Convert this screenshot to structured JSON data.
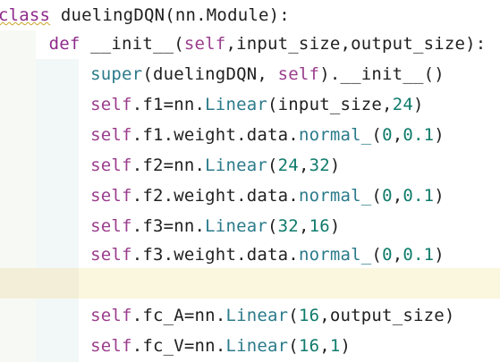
{
  "editor": {
    "lines": [
      {
        "parts": [
          {
            "t": "class",
            "c": "kw",
            "sq": true
          },
          {
            "t": " duelingDQN",
            "c": "cls"
          },
          {
            "t": "(",
            "c": "op"
          },
          {
            "t": "nn",
            "c": "id"
          },
          {
            "t": ".",
            "c": "op"
          },
          {
            "t": "Module",
            "c": "id"
          },
          {
            "t": "):",
            "c": "op"
          }
        ]
      },
      {
        "parts": [
          {
            "t": "    ",
            "c": "op"
          },
          {
            "t": "def",
            "c": "kw"
          },
          {
            "t": " ",
            "c": "op"
          },
          {
            "t": "__init__",
            "c": "fn"
          },
          {
            "t": "(",
            "c": "op"
          },
          {
            "t": "self",
            "c": "self"
          },
          {
            "t": ",",
            "c": "op"
          },
          {
            "t": "input_size",
            "c": "id"
          },
          {
            "t": ",",
            "c": "op"
          },
          {
            "t": "output_size",
            "c": "id"
          },
          {
            "t": "):",
            "c": "op"
          }
        ]
      },
      {
        "parts": [
          {
            "t": "        ",
            "c": "op"
          },
          {
            "t": "super",
            "c": "call"
          },
          {
            "t": "(",
            "c": "op"
          },
          {
            "t": "duelingDQN",
            "c": "id"
          },
          {
            "t": ", ",
            "c": "op"
          },
          {
            "t": "self",
            "c": "self"
          },
          {
            "t": ").",
            "c": "op"
          },
          {
            "t": "__init__",
            "c": "fn"
          },
          {
            "t": "()",
            "c": "op"
          }
        ]
      },
      {
        "parts": [
          {
            "t": "        ",
            "c": "op"
          },
          {
            "t": "self",
            "c": "self"
          },
          {
            "t": ".",
            "c": "op"
          },
          {
            "t": "f1",
            "c": "id"
          },
          {
            "t": "=",
            "c": "op"
          },
          {
            "t": "nn",
            "c": "id"
          },
          {
            "t": ".",
            "c": "op"
          },
          {
            "t": "Linear",
            "c": "call"
          },
          {
            "t": "(",
            "c": "op"
          },
          {
            "t": "input_size",
            "c": "id"
          },
          {
            "t": ",",
            "c": "op"
          },
          {
            "t": "24",
            "c": "num"
          },
          {
            "t": ")",
            "c": "op"
          }
        ]
      },
      {
        "parts": [
          {
            "t": "        ",
            "c": "op"
          },
          {
            "t": "self",
            "c": "self"
          },
          {
            "t": ".",
            "c": "op"
          },
          {
            "t": "f1",
            "c": "id"
          },
          {
            "t": ".",
            "c": "op"
          },
          {
            "t": "weight",
            "c": "id"
          },
          {
            "t": ".",
            "c": "op"
          },
          {
            "t": "data",
            "c": "id"
          },
          {
            "t": ".",
            "c": "op"
          },
          {
            "t": "normal_",
            "c": "call"
          },
          {
            "t": "(",
            "c": "op"
          },
          {
            "t": "0",
            "c": "num"
          },
          {
            "t": ",",
            "c": "op"
          },
          {
            "t": "0.1",
            "c": "num"
          },
          {
            "t": ")",
            "c": "op"
          }
        ]
      },
      {
        "parts": [
          {
            "t": "        ",
            "c": "op"
          },
          {
            "t": "self",
            "c": "self"
          },
          {
            "t": ".",
            "c": "op"
          },
          {
            "t": "f2",
            "c": "id"
          },
          {
            "t": "=",
            "c": "op"
          },
          {
            "t": "nn",
            "c": "id"
          },
          {
            "t": ".",
            "c": "op"
          },
          {
            "t": "Linear",
            "c": "call"
          },
          {
            "t": "(",
            "c": "op"
          },
          {
            "t": "24",
            "c": "num"
          },
          {
            "t": ",",
            "c": "op"
          },
          {
            "t": "32",
            "c": "num"
          },
          {
            "t": ")",
            "c": "op"
          }
        ]
      },
      {
        "parts": [
          {
            "t": "        ",
            "c": "op"
          },
          {
            "t": "self",
            "c": "self"
          },
          {
            "t": ".",
            "c": "op"
          },
          {
            "t": "f2",
            "c": "id"
          },
          {
            "t": ".",
            "c": "op"
          },
          {
            "t": "weight",
            "c": "id"
          },
          {
            "t": ".",
            "c": "op"
          },
          {
            "t": "data",
            "c": "id"
          },
          {
            "t": ".",
            "c": "op"
          },
          {
            "t": "normal_",
            "c": "call"
          },
          {
            "t": "(",
            "c": "op"
          },
          {
            "t": "0",
            "c": "num"
          },
          {
            "t": ",",
            "c": "op"
          },
          {
            "t": "0.1",
            "c": "num"
          },
          {
            "t": ")",
            "c": "op"
          }
        ]
      },
      {
        "parts": [
          {
            "t": "        ",
            "c": "op"
          },
          {
            "t": "self",
            "c": "self"
          },
          {
            "t": ".",
            "c": "op"
          },
          {
            "t": "f3",
            "c": "id"
          },
          {
            "t": "=",
            "c": "op"
          },
          {
            "t": "nn",
            "c": "id"
          },
          {
            "t": ".",
            "c": "op"
          },
          {
            "t": "Linear",
            "c": "call"
          },
          {
            "t": "(",
            "c": "op"
          },
          {
            "t": "32",
            "c": "num"
          },
          {
            "t": ",",
            "c": "op"
          },
          {
            "t": "16",
            "c": "num"
          },
          {
            "t": ")",
            "c": "op"
          }
        ]
      },
      {
        "parts": [
          {
            "t": "        ",
            "c": "op"
          },
          {
            "t": "self",
            "c": "self"
          },
          {
            "t": ".",
            "c": "op"
          },
          {
            "t": "f3",
            "c": "id"
          },
          {
            "t": ".",
            "c": "op"
          },
          {
            "t": "weight",
            "c": "id"
          },
          {
            "t": ".",
            "c": "op"
          },
          {
            "t": "data",
            "c": "id"
          },
          {
            "t": ".",
            "c": "op"
          },
          {
            "t": "normal_",
            "c": "call"
          },
          {
            "t": "(",
            "c": "op"
          },
          {
            "t": "0",
            "c": "num"
          },
          {
            "t": ",",
            "c": "op"
          },
          {
            "t": "0.1",
            "c": "num"
          },
          {
            "t": ")",
            "c": "op"
          }
        ]
      },
      {
        "parts": []
      },
      {
        "parts": [
          {
            "t": "        ",
            "c": "op"
          },
          {
            "t": "self",
            "c": "self"
          },
          {
            "t": ".",
            "c": "op"
          },
          {
            "t": "fc_A",
            "c": "id"
          },
          {
            "t": "=",
            "c": "op"
          },
          {
            "t": "nn",
            "c": "id"
          },
          {
            "t": ".",
            "c": "op"
          },
          {
            "t": "Linear",
            "c": "call"
          },
          {
            "t": "(",
            "c": "op"
          },
          {
            "t": "16",
            "c": "num"
          },
          {
            "t": ",",
            "c": "op"
          },
          {
            "t": "output_size",
            "c": "id"
          },
          {
            "t": ")",
            "c": "op"
          }
        ]
      },
      {
        "parts": [
          {
            "t": "        ",
            "c": "op"
          },
          {
            "t": "self",
            "c": "self"
          },
          {
            "t": ".",
            "c": "op"
          },
          {
            "t": "fc_V",
            "c": "id"
          },
          {
            "t": "=",
            "c": "op"
          },
          {
            "t": "nn",
            "c": "id"
          },
          {
            "t": ".",
            "c": "op"
          },
          {
            "t": "Linear",
            "c": "call"
          },
          {
            "t": "(",
            "c": "op"
          },
          {
            "t": "16",
            "c": "num"
          },
          {
            "t": ",",
            "c": "op"
          },
          {
            "t": "1",
            "c": "num"
          },
          {
            "t": ")",
            "c": "op"
          }
        ]
      }
    ],
    "current_line_index": 9,
    "colors": {
      "keyword": "#8e2b8b",
      "self": "#9a3d8c",
      "call": "#2a7a8a",
      "number": "#0f7b6b",
      "text": "#1f1f1f",
      "current_line": "#fbf6de",
      "background": "#ffffff"
    }
  }
}
